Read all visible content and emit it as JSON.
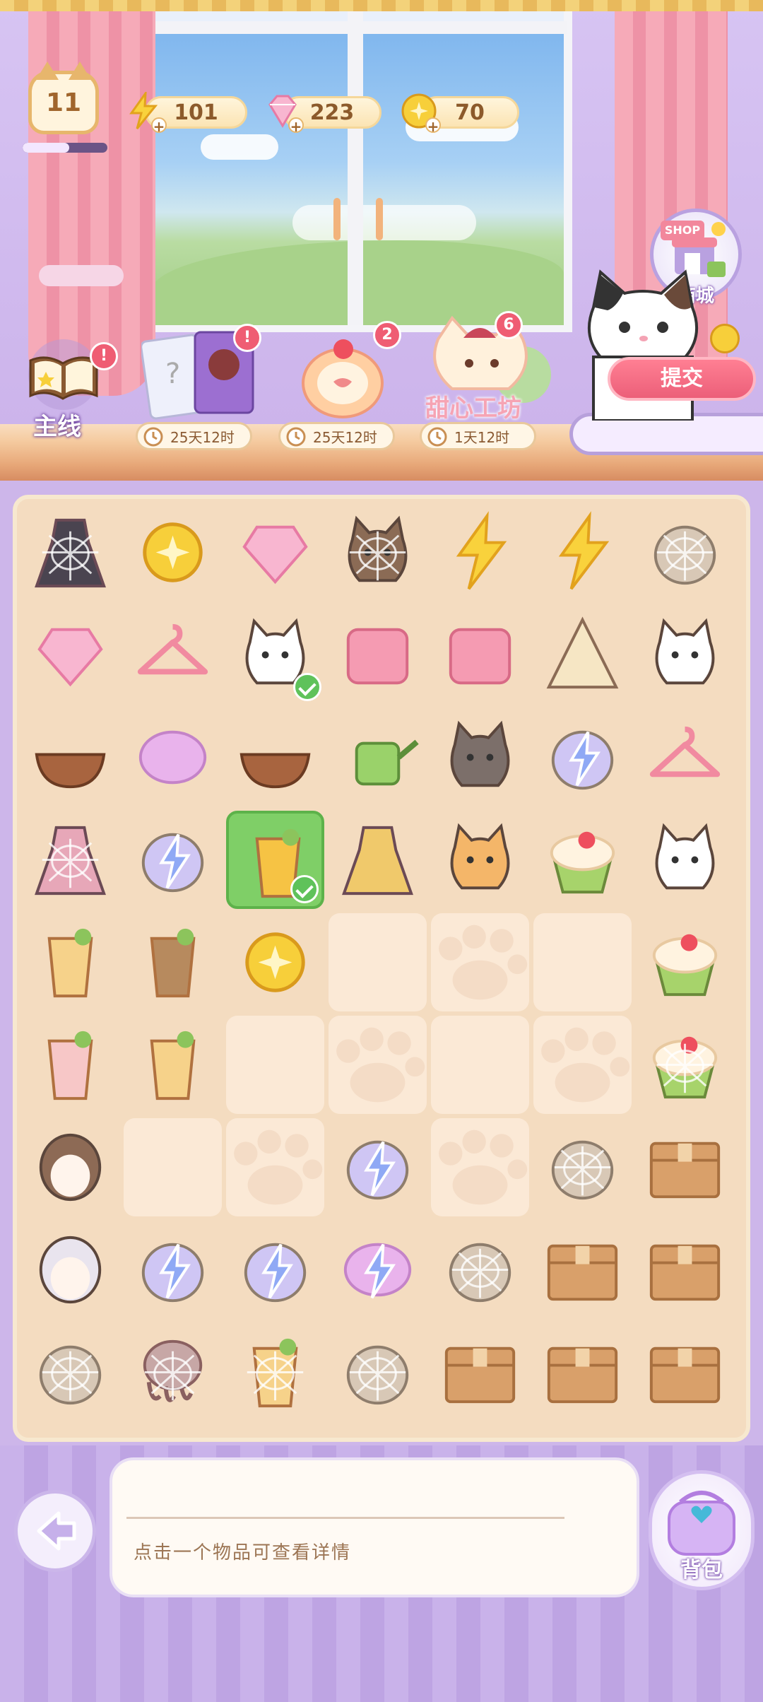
{
  "hud": {
    "level": "11",
    "xp_progress": 0.55,
    "energy": "101",
    "gems": "223",
    "coins": "70"
  },
  "shop": {
    "sign": "SHOP",
    "label": "商城"
  },
  "submit": {
    "label": "提交"
  },
  "quests": [
    {
      "id": "main",
      "label": "主线",
      "badge": "!"
    },
    {
      "id": "cards",
      "badge": "!",
      "timer": "25天12时"
    },
    {
      "id": "cake",
      "badge": "2",
      "timer": "25天12时"
    },
    {
      "id": "workshop",
      "label": "甜心工坊",
      "badge": "6",
      "timer": "1天12时"
    }
  ],
  "board": {
    "rows": [
      [
        "dress-dark-cobweb",
        "coins-pile",
        "gems-pink",
        "cat-brown-cobweb",
        "energy-bolts",
        "energy-bolt",
        "clothes-rack-cobweb"
      ],
      [
        "gems-pink-big",
        "hanger-towel",
        "cat-calico",
        "cushion-pink",
        "towel-pink",
        "tent-teepee",
        "taco-cat"
      ],
      [
        "bowl-brown",
        "bubble-pink",
        "cereal-bowl",
        "watering-can",
        "cat-gray",
        "lamp-lightning",
        "hanger-pink"
      ],
      [
        "dress-pink-cobweb",
        "flower-crate-lightning",
        "drink-orange",
        "dress-gold",
        "cat-orange",
        "cake-slice",
        "teapot-cat"
      ],
      [
        "tea-cup",
        "iced-coffee",
        "coin",
        "empty",
        "empty-paw",
        "empty",
        "cupcake-green"
      ],
      [
        "strawberry-drink",
        "lemon-tea",
        "empty",
        "empty-paw",
        "empty",
        "empty-paw",
        "cupcake-cobweb"
      ],
      [
        "girl-hair-brown",
        "empty",
        "empty-paw",
        "swing-lightning",
        "empty-paw",
        "shell-cobweb",
        "box"
      ],
      [
        "girl-hair-white",
        "vending-lightning",
        "bike-lightning",
        "bubble-lightning",
        "hat-cobweb",
        "box",
        "box"
      ],
      [
        "cart-cobweb",
        "octopus-cobweb",
        "berry-drink-cobweb",
        "egg-cobweb",
        "box",
        "box",
        "box"
      ]
    ],
    "selected_cell": "3-2",
    "checked_cells": [
      "1-2",
      "3-2"
    ]
  },
  "info": {
    "text": "点击一个物品可查看详情"
  },
  "bag": {
    "label": "背包"
  }
}
